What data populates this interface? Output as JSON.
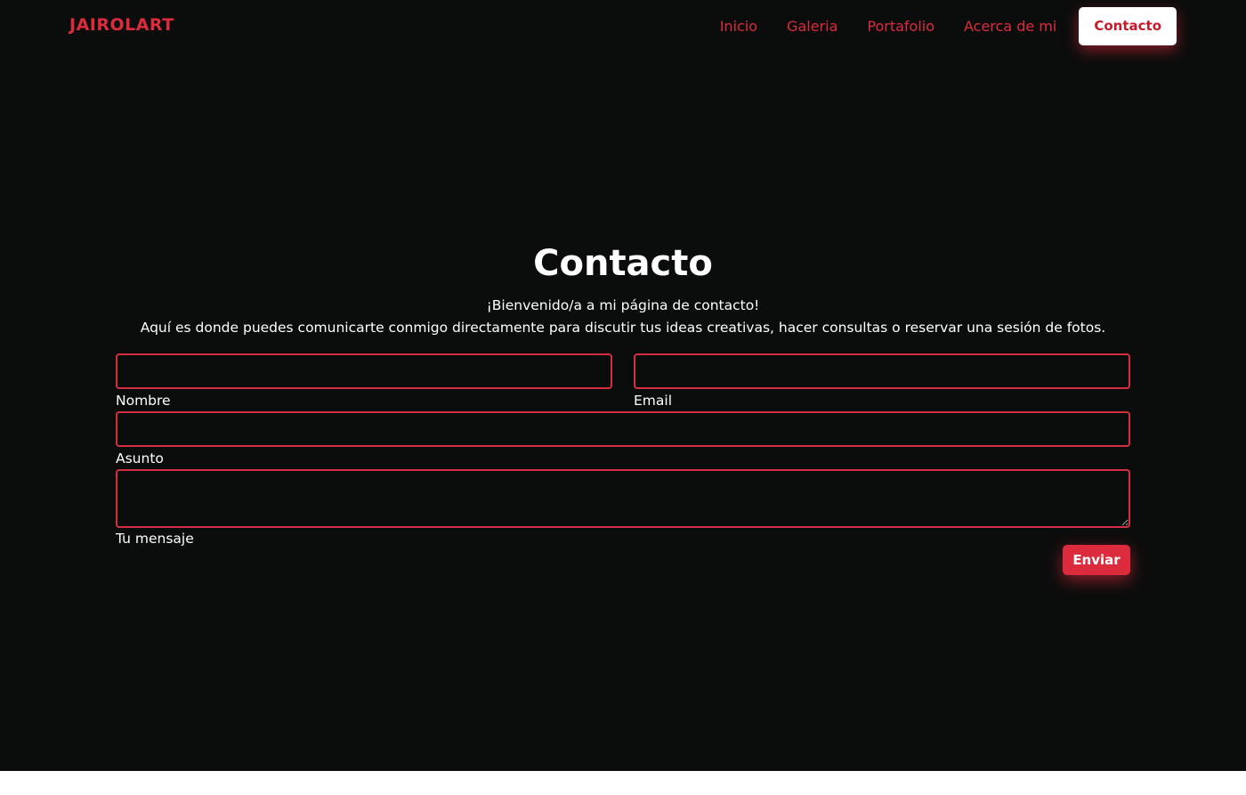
{
  "brand": "JAIROLART",
  "nav": {
    "items": [
      "Inicio",
      "Galeria",
      "Portafolio",
      "Acerca de mi"
    ],
    "active": "Contacto"
  },
  "hero": {
    "title": "Contacto",
    "greeting": "¡Bienvenido/a a mi página de contacto!",
    "description": "Aquí es donde puedes comunicarte conmigo directamente para discutir tus ideas creativas, hacer consultas o reservar una sesión de fotos."
  },
  "form": {
    "name_label": "Nombre",
    "name_value": "",
    "email_label": "Email",
    "email_value": "",
    "subject_label": "Asunto",
    "subject_value": "",
    "message_label": "Tu mensaje",
    "message_value": "",
    "submit_label": "Enviar"
  },
  "colors": {
    "background": "#0b0d0c",
    "accent": "#dc2b3c",
    "text": "#ffffff"
  }
}
